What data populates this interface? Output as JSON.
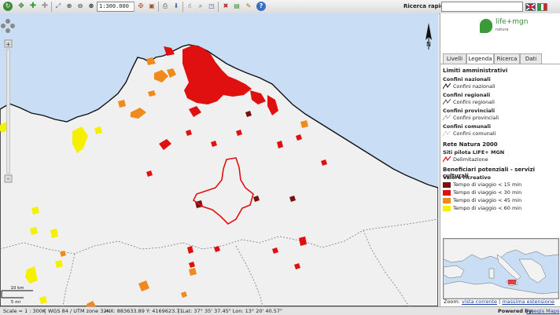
{
  "toolbar": {
    "scale_value": "1:300.000",
    "search_label": "Ricerca rapida:",
    "search_value": "",
    "help_glyph": "?"
  },
  "flags": [
    {
      "name": "uk-flag-icon",
      "color": "#1d3f8f"
    },
    {
      "name": "italy-flag-icon",
      "color": "#cc2a2a"
    }
  ],
  "logo": {
    "name": "life+mgn",
    "tagline": "natura"
  },
  "tabs": [
    "Livelli",
    "Legenda",
    "Ricerca",
    "Dati"
  ],
  "active_tab": "Legenda",
  "legend": {
    "section1": "Limiti amministrativi",
    "nat_title": "Confini nazionali",
    "nat_item": "Confini nazionali",
    "reg_title": "Confini regionali",
    "reg_item": "Confini regionali",
    "prov_title": "Confini provinciali",
    "prov_item": "Confini provinciali",
    "com_title": "Confini comunali",
    "com_item": "Confini comunali",
    "section2": "Rete Natura 2000",
    "sites_title": "Siti pilota LIFE+ MGN",
    "sites_item": "Delimitazione",
    "section3": "Beneficiari potenziali - servizi culturali",
    "value_title": "Valore ricreativo",
    "classes": [
      {
        "label": "Tempo di viaggio < 15 min",
        "color": "#7a0f0f"
      },
      {
        "label": "Tempo di viaggio < 30 min",
        "color": "#e01010"
      },
      {
        "label": "Tempo di viaggio < 45 min",
        "color": "#f08a1c"
      },
      {
        "label": "Tempo di viaggio < 60 min",
        "color": "#f5f000"
      }
    ]
  },
  "overview": {
    "zoom_label": "Zoom:",
    "link1": "vista corrente",
    "link2": "massima estensione",
    "separator": "|"
  },
  "map": {
    "north_label": "N",
    "scalebar_top": "10 km",
    "scalebar_bottom": "5 mi"
  },
  "status": {
    "scale": "Scale = 1 : 300K",
    "crs": "WGS 84 / UTM zone 32N",
    "coords": "X: 883633.89 Y: 4169623.71",
    "latlon": "Lat: 37° 35' 37.45\" Lon: 13° 20' 40.57\"",
    "powered_label": "Powered by:",
    "powered_link": "Freegis Maps"
  },
  "colors": {
    "sea": "#c9def5",
    "land": "#f0f0f0",
    "class_15": "#7a0f0f",
    "class_30": "#e01010",
    "class_45": "#f08a1c",
    "class_60": "#f5f000",
    "site_outline": "#e01010"
  }
}
